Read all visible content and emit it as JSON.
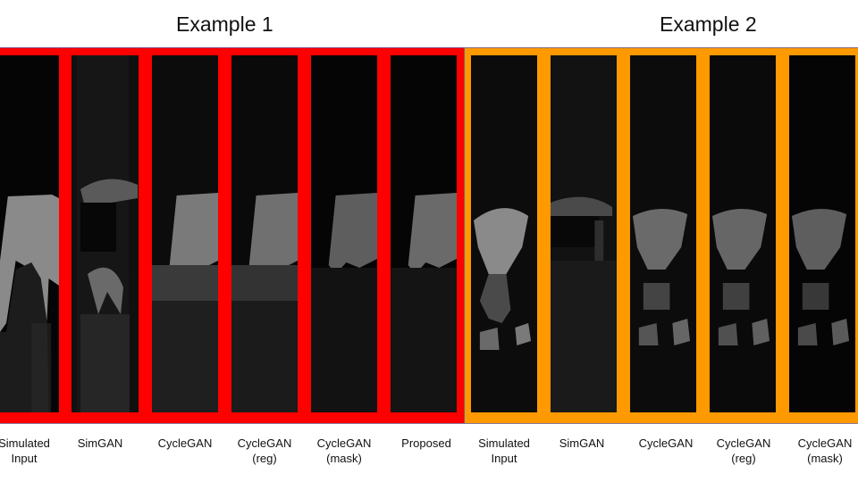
{
  "figure": {
    "examples": [
      {
        "title": "Example 1",
        "frame_color": "#ff0000",
        "panels": [
          {
            "label_line1": "Simulated",
            "label_line2": "Input"
          },
          {
            "label_line1": "SimGAN",
            "label_line2": ""
          },
          {
            "label_line1": "CycleGAN",
            "label_line2": ""
          },
          {
            "label_line1": "CycleGAN",
            "label_line2": "(reg)"
          },
          {
            "label_line1": "CycleGAN",
            "label_line2": "(mask)"
          },
          {
            "label_line1": "Proposed",
            "label_line2": ""
          }
        ]
      },
      {
        "title": "Example 2",
        "frame_color": "#ff9900",
        "panels": [
          {
            "label_line1": "Simulated",
            "label_line2": "Input"
          },
          {
            "label_line1": "SimGAN",
            "label_line2": ""
          },
          {
            "label_line1": "CycleGAN",
            "label_line2": ""
          },
          {
            "label_line1": "CycleGAN",
            "label_line2": "(reg)"
          },
          {
            "label_line1": "CycleGAN",
            "label_line2": "(mask)"
          }
        ]
      }
    ]
  }
}
